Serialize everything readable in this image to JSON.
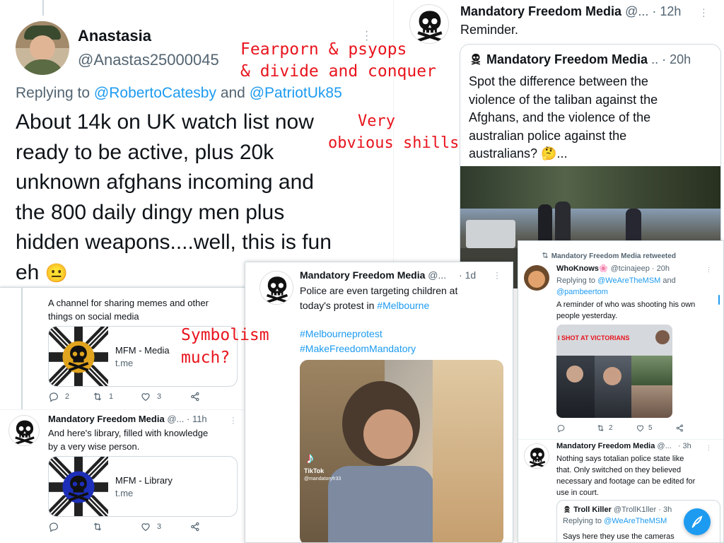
{
  "annotations": {
    "fearporn_line1": "Fearporn & psyops",
    "fearporn_line2": "& divide and conquer",
    "shills_line1": "Very",
    "shills_line2": "obvious shills",
    "symbolism_line1": "Symbolism",
    "symbolism_line2": "much?"
  },
  "anastasia": {
    "name": "Anastasia",
    "handle": "@Anastas25000045",
    "replying_prefix": "Replying to",
    "reply_to_1": "@RobertoCatesby",
    "reply_and": "and",
    "reply_to_2": "@PatriotUk85",
    "text_line1": "About 14k on UK watch list now",
    "text_line2": "ready to be active, plus 20k",
    "text_line3": "unknown afghans incoming and",
    "text_line4": "the 800 daily dingy men plus",
    "text_line5": "hidden weapons....well, this is fun",
    "text_line6": "eh",
    "emoji": "😐"
  },
  "reminder": {
    "name": "Mandatory Freedom Media",
    "handle": "@...",
    "time": "· 12h",
    "text": "Reminder.",
    "quote": {
      "name": "Mandatory Freedom Media",
      "handle": "..",
      "time": "· 20h",
      "line1": "Spot the difference between the",
      "line2": "violence of the taliban against the",
      "line3": "Afghans, and the violence of the",
      "line4": "australian police against the",
      "line5": "australians? 🤔..."
    }
  },
  "channel": {
    "desc_line1": "A channel for sharing memes and other",
    "desc_line2": "things on social media",
    "card1_title": "MFM - Media",
    "card1_domain": "t.me",
    "replies": "2",
    "retweets": "1",
    "likes": "3",
    "library_name": "Mandatory Freedom Media",
    "library_handle": "@...",
    "library_time": "· 11h",
    "library_line1": "And here's library, filled with knowledge",
    "library_line2": "by a very wise person.",
    "card2_title": "MFM - Library",
    "card2_domain": "t.me",
    "likes2": "3"
  },
  "melbourne": {
    "name": "Mandatory Freedom Media",
    "handle": "@...",
    "time": "· 1d",
    "line1": "Police are even targeting children at",
    "line2_prefix": "today's protest in",
    "line2_tag": "#Melbourne",
    "hashtag1": "#Melbourneprotest",
    "hashtag2": "#MakeFreedomMandatory",
    "tiktok_label": "TikTok",
    "tiktok_handle": "@mandatoryfr33"
  },
  "right_panel": {
    "retweeted": "Mandatory Freedom Media retweeted",
    "whoknows_name": "WhoKnows🌸",
    "whoknows_handle": "@tcinajeep",
    "whoknows_time": "· 20h",
    "replying_prefix": "Replying to",
    "reply_to_1": "@WeAreTheMSM",
    "reply_and": "and",
    "reply_to_2": "@pambeertom",
    "text_line1": "A reminder of who was shooting his own",
    "text_line2": "people yesterday.",
    "image_caption": "I SHOT AT VICTORIANS",
    "retweets": "2",
    "likes": "5",
    "mfm_name": "Mandatory Freedom Media",
    "mfm_handle": "@...",
    "mfm_time": "· 3h",
    "mfm_line1": "Nothing says totalian police state like",
    "mfm_line2": "that. Only switched on they believed",
    "mfm_line3": "necessary and footage can be edited for",
    "mfm_line4": "use in court.",
    "troll_name": "Troll Killer",
    "troll_handle": "@TrollK1ller",
    "troll_time": "· 3h",
    "troll_reply_prefix": "Replying to",
    "troll_reply_to": "@WeAreTheMSM",
    "troll_text": "Says here they use the cameras"
  },
  "icons": {
    "reply": "reply-icon",
    "retweet": "retweet-icon",
    "like": "heart-icon",
    "share": "share-icon",
    "compose": "compose-icon"
  },
  "colors": {
    "accent": "#1d9bf0",
    "annotation_red": "#e8141d",
    "secondary_text": "#536471"
  }
}
